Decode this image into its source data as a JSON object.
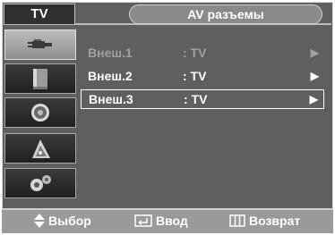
{
  "header": {
    "tab_label": "TV",
    "title": "AV разъемы"
  },
  "sidebar": {
    "icons": [
      "antenna-plug-icon",
      "picture-icon",
      "speaker-icon",
      "channel-icon",
      "setup-icon"
    ],
    "active_index": 0
  },
  "menu": {
    "rows": [
      {
        "name": "Внеш.1",
        "value": ": TV",
        "arrow": "▶",
        "state": "dimmed"
      },
      {
        "name": "Внеш.2",
        "value": ": TV",
        "arrow": "▶",
        "state": "normal"
      },
      {
        "name": "Внеш.3",
        "value": ": TV",
        "arrow": "▶",
        "state": "selected"
      }
    ]
  },
  "footer": {
    "select_label": "Выбор",
    "enter_label": "Ввод",
    "return_label": "Возврат"
  },
  "colors": {
    "background": "#5f5f5f",
    "footer": "#9a9a9a",
    "dim_text": "#a0a0a0",
    "text": "#ffffff"
  }
}
